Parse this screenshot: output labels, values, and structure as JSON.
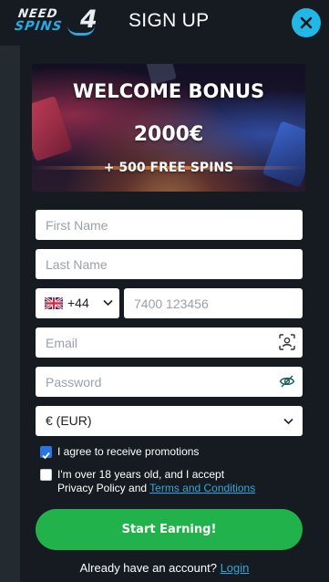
{
  "header": {
    "logo_line1": "NEED",
    "logo_line2": "SPINS",
    "logo_mark": "4",
    "title": "SIGN UP",
    "close_icon": "close-icon"
  },
  "banner": {
    "title": "WELCOME BONUS",
    "amount": "2000€",
    "spins": "+ 500 FREE SPINS"
  },
  "form": {
    "first_name_placeholder": "First Name",
    "last_name_placeholder": "Last Name",
    "dial_code": "+44",
    "dial_flag": "uk-flag-icon",
    "phone_placeholder": "7400 123456",
    "email_placeholder": "Email",
    "password_placeholder": "Password",
    "currency": "€ (EUR)",
    "promotions_label": "I agree to receive promotions",
    "promotions_checked": true,
    "age_label_line1": "I'm over 18 years old, and I accept",
    "age_label_prefix": "Privacy Policy and ",
    "terms_link": "Terms and Conditions",
    "age_checked": false,
    "submit_label": "Start Earning!"
  },
  "footer": {
    "prompt": "Already have an account?",
    "login_link": "Login"
  },
  "colors": {
    "accent_blue": "#21b7e6",
    "cta_green": "#22b24c",
    "link_blue": "#2fa8de",
    "panel": "#151b20"
  }
}
